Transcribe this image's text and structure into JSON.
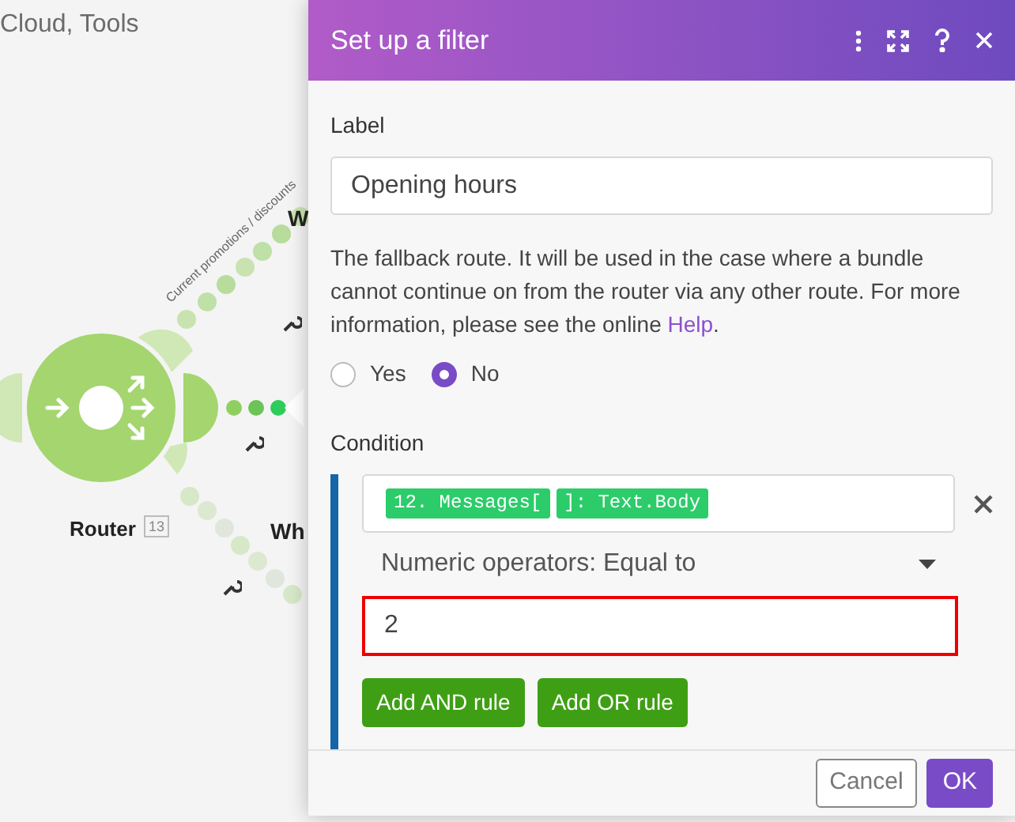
{
  "canvas": {
    "breadcrumb": "Cloud, Tools",
    "route_label": "Current promotions / discounts",
    "router": {
      "name": "Router",
      "badge": "13"
    },
    "cut_labels": [
      "W",
      "Wh"
    ]
  },
  "dialog": {
    "title": "Set up a filter",
    "label_caption": "Label",
    "label_value": "Opening hours",
    "description": "The fallback route. It will be used in the case where a bundle cannot continue on from the router via any other route. For more information, please see the online ",
    "help_link": "Help",
    "description_end": ".",
    "fallback_options": [
      {
        "label": "Yes",
        "selected": false
      },
      {
        "label": "No",
        "selected": true
      }
    ],
    "condition_caption": "Condition",
    "tokens": [
      "12. Messages[",
      "]: Text.Body"
    ],
    "operator": "Numeric operators: Equal to",
    "value": {
      "text": "2",
      "invalid": true
    },
    "rule_buttons": [
      "Add AND rule",
      "Add OR rule"
    ],
    "footer_buttons": [
      {
        "label": "Cancel",
        "kind": "secondary"
      },
      {
        "label": "OK",
        "kind": "primary"
      }
    ]
  }
}
